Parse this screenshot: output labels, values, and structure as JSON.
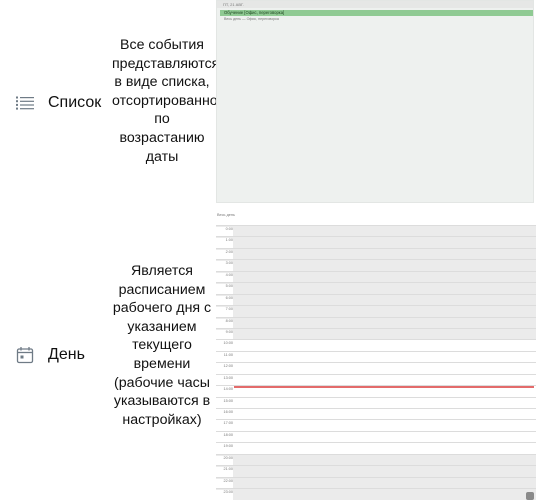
{
  "list_mode": {
    "label": "Список",
    "icon": "list-icon",
    "description": "Все события представляются в виде списка, отсортированного по возрастанию даты",
    "preview": {
      "date_header": "ПТ, 21 АВГ.",
      "event_title": "Обучение [Офис, переговорка]",
      "event_sub": "Весь день — Офис, переговорка",
      "event_color": "#8fca93"
    }
  },
  "day_mode": {
    "label": "День",
    "icon": "calendar-day-icon",
    "description": "Является расписанием рабочего дня с указанием текущего времени (рабочие часы указываются в настройках)",
    "preview": {
      "all_day_label": "Весь день",
      "hours": [
        "0:00",
        "1:00",
        "2:00",
        "3:00",
        "4:00",
        "5:00",
        "6:00",
        "7:00",
        "8:00",
        "9:00",
        "10:00",
        "11:00",
        "12:00",
        "13:00",
        "14:00",
        "15:00",
        "16:00",
        "17:00",
        "18:00",
        "19:00",
        "20:00",
        "21:00",
        "22:00",
        "23:00"
      ],
      "working_hours": [
        10,
        20
      ],
      "now_hour": 14.1,
      "now_color": "#e36b6b",
      "fab_icon": "calendar-icon"
    }
  }
}
